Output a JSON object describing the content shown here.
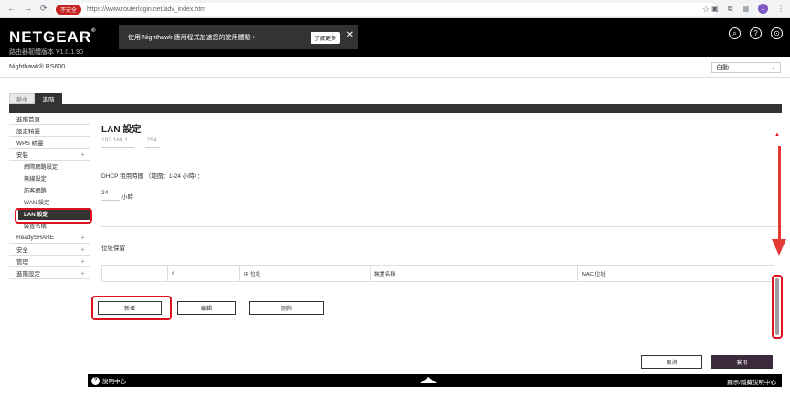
{
  "browser": {
    "nav_back": "←",
    "nav_forward": "→",
    "nav_reload": "⟳",
    "secure_badge": "不安全",
    "url": "https://www.routerlogin.net/adv_index.htm",
    "star": "☆",
    "avatar_letter": "J"
  },
  "header": {
    "logo": "NETGEAR",
    "logo_mark": "®",
    "firmware": "路由器韌體版本 V1.0.1.90",
    "banner_text": "使用 Nighthawk 應用程式加速您的使用體驗 •",
    "banner_learn": "了解更多",
    "banner_close": "✕",
    "icon_search": "⌕",
    "icon_help": "?",
    "icon_user": "⊙"
  },
  "model": "Nighthawk® RS600",
  "language": {
    "value": "自動",
    "arrow": "⌄"
  },
  "tabs": {
    "basic": "基本",
    "advanced": "進階"
  },
  "sidebar": {
    "items": [
      {
        "label": "進階首頁",
        "plus": ""
      },
      {
        "label": "設定精靈",
        "plus": ""
      },
      {
        "label": "WPS 精靈",
        "plus": ""
      },
      {
        "label": "安裝",
        "plus": "+"
      }
    ],
    "sub_items": [
      {
        "label": "網際網路設定"
      },
      {
        "label": "無線設定"
      },
      {
        "label": "訪客網路"
      },
      {
        "label": "WAN 設定"
      },
      {
        "label": "LAN 設定"
      },
      {
        "label": "裝置名稱"
      }
    ],
    "lower_items": [
      {
        "label": "ReadySHARE",
        "plus": "+"
      },
      {
        "label": "安全",
        "plus": "+"
      },
      {
        "label": "管理",
        "plus": "+"
      },
      {
        "label": "進階設定",
        "plus": "+"
      }
    ]
  },
  "content": {
    "title": "LAN 設定",
    "ip_prefix": "192.168.1",
    "ip_last": ".254",
    "dhcp_label": "DHCP 租用時間 （範圍：1-24 小時）：",
    "lease_value": "24",
    "lease_unit": "小時",
    "reservation_label": "位址保留",
    "table_headers": [
      "",
      "#",
      "IP 位址",
      "裝置名稱",
      "MAC 位址"
    ],
    "btn_add": "新增",
    "btn_edit": "編輯",
    "btn_delete": "刪除",
    "btn_cancel": "取消",
    "btn_apply": "套用"
  },
  "footer": {
    "help_icon": "?",
    "help_label": "說明中心",
    "show_hide": "顯示/隱藏說明中心"
  }
}
